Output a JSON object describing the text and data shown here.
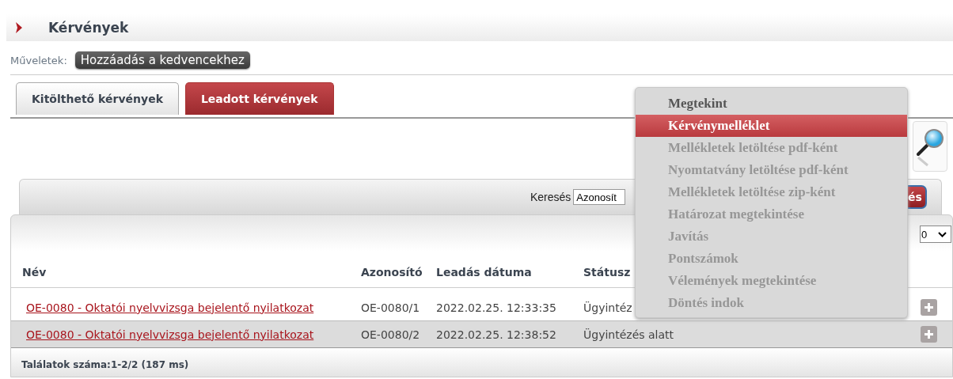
{
  "page": {
    "title": "Kérvények"
  },
  "actions": {
    "label": "Műveletek:",
    "buttons": [
      "Hozzáadás a kedvencekhez"
    ]
  },
  "tabs": [
    {
      "label": "Kitölthető kérvények",
      "selected": false
    },
    {
      "label": "Leadott kérvények",
      "selected": true
    }
  ],
  "search": {
    "label": "Keresés",
    "value": "Azonosít",
    "button": "és"
  },
  "page_size": {
    "value": "0"
  },
  "table": {
    "columns": [
      "Név",
      "Azonosító",
      "Leadás dátuma",
      "Státusz"
    ],
    "rows": [
      {
        "cells": [
          "OE-0080 - Oktatói nyelvvizsga bejelentő nyilatkozat",
          "OE-0080/1",
          "2022.02.25. 12:33:35",
          "Ügyintéz"
        ],
        "selected": false
      },
      {
        "cells": [
          "OE-0080 - Oktatói nyelvvizsga bejelentő nyilatkozat",
          "OE-0080/2",
          "2022.02.25. 12:38:52",
          "Ügyintézés alatt"
        ],
        "selected": true
      }
    ],
    "footer": "Találatok száma:1-2/2 (187 ms)"
  },
  "context_menu": {
    "items": [
      {
        "label": "Megtekint",
        "selected": false,
        "disabled": false
      },
      {
        "label": "Kérvénymelléklet",
        "selected": true,
        "disabled": false
      },
      {
        "label": "Mellékletek letöltése pdf-ként",
        "selected": false,
        "disabled": true
      },
      {
        "label": "Nyomtatvány letöltése pdf-ként",
        "selected": false,
        "disabled": true
      },
      {
        "label": "Mellékletek letöltése zip-ként",
        "selected": false,
        "disabled": true
      },
      {
        "label": "Határozat megtekintése",
        "selected": false,
        "disabled": true
      },
      {
        "label": "Javítás",
        "selected": false,
        "disabled": true
      },
      {
        "label": "Pontszámok",
        "selected": false,
        "disabled": true
      },
      {
        "label": "Vélemények megtekintése",
        "selected": false,
        "disabled": true
      },
      {
        "label": "Döntés indok",
        "selected": false,
        "disabled": true
      }
    ]
  }
}
